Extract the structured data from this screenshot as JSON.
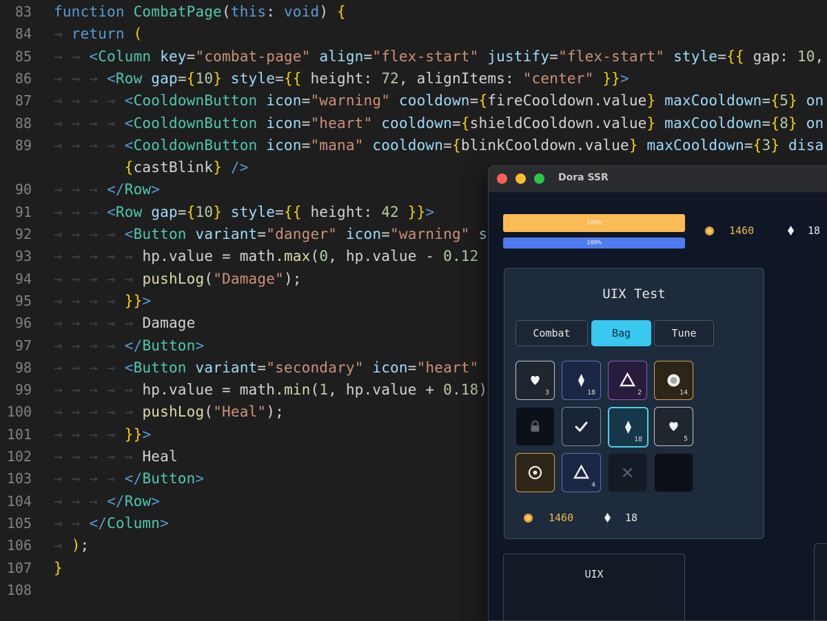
{
  "editor": {
    "lines": [
      {
        "n": "83",
        "t": [
          [
            "kw",
            "function "
          ],
          [
            "fn",
            "CombatPage"
          ],
          [
            "punct",
            "("
          ],
          [
            "kw",
            "this"
          ],
          [
            "punct",
            ": "
          ],
          [
            "kw",
            "void"
          ],
          [
            "punct",
            ") "
          ],
          [
            "brace",
            "{"
          ]
        ]
      },
      {
        "n": "84",
        "t": [
          [
            "guide",
            "→ "
          ],
          [
            "kw",
            "return "
          ],
          [
            "brace",
            "("
          ]
        ]
      },
      {
        "n": "85",
        "t": [
          [
            "guide",
            "→ → "
          ],
          [
            "tag",
            "<"
          ],
          [
            "comp",
            "Column "
          ],
          [
            "attr",
            "key"
          ],
          [
            "punct",
            "="
          ],
          [
            "str",
            "\"combat-page\" "
          ],
          [
            "attr",
            "align"
          ],
          [
            "punct",
            "="
          ],
          [
            "str",
            "\"flex-start\" "
          ],
          [
            "attr",
            "justify"
          ],
          [
            "punct",
            "="
          ],
          [
            "str",
            "\"flex-start\" "
          ],
          [
            "attr",
            "style"
          ],
          [
            "punct",
            "="
          ],
          [
            "brace",
            "{{ "
          ],
          [
            "var",
            "gap: "
          ],
          [
            "num",
            "10"
          ],
          [
            "punct",
            ","
          ]
        ]
      },
      {
        "n": "86",
        "t": [
          [
            "guide",
            "→ → → "
          ],
          [
            "tag",
            "<"
          ],
          [
            "comp",
            "Row "
          ],
          [
            "attr",
            "gap"
          ],
          [
            "punct",
            "="
          ],
          [
            "brace",
            "{"
          ],
          [
            "num",
            "10"
          ],
          [
            "brace",
            "}"
          ],
          [
            "attr",
            " style"
          ],
          [
            "punct",
            "="
          ],
          [
            "brace",
            "{{ "
          ],
          [
            "var",
            "height: "
          ],
          [
            "num",
            "72"
          ],
          [
            "punct",
            ", "
          ],
          [
            "var",
            "alignItems: "
          ],
          [
            "str",
            "\"center\" "
          ],
          [
            "brace",
            "}}"
          ],
          [
            "tag",
            ">"
          ]
        ]
      },
      {
        "n": "87",
        "t": [
          [
            "guide",
            "→ → → → "
          ],
          [
            "tag",
            "<"
          ],
          [
            "comp",
            "CooldownButton "
          ],
          [
            "attr",
            "icon"
          ],
          [
            "punct",
            "="
          ],
          [
            "str",
            "\"warning\" "
          ],
          [
            "attr",
            "cooldown"
          ],
          [
            "punct",
            "="
          ],
          [
            "brace",
            "{"
          ],
          [
            "var",
            "fireCooldown.value"
          ],
          [
            "brace",
            "}"
          ],
          [
            "attr",
            " maxCooldown"
          ],
          [
            "punct",
            "="
          ],
          [
            "brace",
            "{"
          ],
          [
            "num",
            "5"
          ],
          [
            "brace",
            "}"
          ],
          [
            "attr",
            " on"
          ]
        ]
      },
      {
        "n": "88",
        "t": [
          [
            "guide",
            "→ → → → "
          ],
          [
            "tag",
            "<"
          ],
          [
            "comp",
            "CooldownButton "
          ],
          [
            "attr",
            "icon"
          ],
          [
            "punct",
            "="
          ],
          [
            "str",
            "\"heart\" "
          ],
          [
            "attr",
            "cooldown"
          ],
          [
            "punct",
            "="
          ],
          [
            "brace",
            "{"
          ],
          [
            "var",
            "shieldCooldown.value"
          ],
          [
            "brace",
            "}"
          ],
          [
            "attr",
            " maxCooldown"
          ],
          [
            "punct",
            "="
          ],
          [
            "brace",
            "{"
          ],
          [
            "num",
            "8"
          ],
          [
            "brace",
            "}"
          ],
          [
            "attr",
            " on"
          ]
        ]
      },
      {
        "n": "89",
        "t": [
          [
            "guide",
            "→ → → → "
          ],
          [
            "tag",
            "<"
          ],
          [
            "comp",
            "CooldownButton "
          ],
          [
            "attr",
            "icon"
          ],
          [
            "punct",
            "="
          ],
          [
            "str",
            "\"mana\" "
          ],
          [
            "attr",
            "cooldown"
          ],
          [
            "punct",
            "="
          ],
          [
            "brace",
            "{"
          ],
          [
            "var",
            "blinkCooldown.value"
          ],
          [
            "brace",
            "}"
          ],
          [
            "attr",
            " maxCooldown"
          ],
          [
            "punct",
            "="
          ],
          [
            "brace",
            "{"
          ],
          [
            "num",
            "3"
          ],
          [
            "brace",
            "}"
          ],
          [
            "attr",
            " disa"
          ]
        ]
      },
      {
        "n": "",
        "t": [
          [
            "guide",
            "        "
          ],
          [
            "brace",
            "{"
          ],
          [
            "var",
            "castBlink"
          ],
          [
            "brace",
            "}"
          ],
          [
            "tag",
            " />"
          ]
        ]
      },
      {
        "n": "90",
        "t": [
          [
            "guide",
            "→ → → "
          ],
          [
            "tag",
            "</"
          ],
          [
            "comp",
            "Row"
          ],
          [
            "tag",
            ">"
          ]
        ]
      },
      {
        "n": "91",
        "t": [
          [
            "guide",
            "→ → → "
          ],
          [
            "tag",
            "<"
          ],
          [
            "comp",
            "Row "
          ],
          [
            "attr",
            "gap"
          ],
          [
            "punct",
            "="
          ],
          [
            "brace",
            "{"
          ],
          [
            "num",
            "10"
          ],
          [
            "brace",
            "}"
          ],
          [
            "attr",
            " style"
          ],
          [
            "punct",
            "="
          ],
          [
            "brace",
            "{{ "
          ],
          [
            "var",
            "height: "
          ],
          [
            "num",
            "42 "
          ],
          [
            "brace",
            "}}"
          ],
          [
            "tag",
            ">"
          ]
        ]
      },
      {
        "n": "92",
        "t": [
          [
            "guide",
            "→ → → → "
          ],
          [
            "tag",
            "<"
          ],
          [
            "comp",
            "Button "
          ],
          [
            "attr",
            "variant"
          ],
          [
            "punct",
            "="
          ],
          [
            "str",
            "\"danger\" "
          ],
          [
            "attr",
            "icon"
          ],
          [
            "punct",
            "="
          ],
          [
            "str",
            "\"warning\" "
          ],
          [
            "attr",
            "s"
          ]
        ]
      },
      {
        "n": "93",
        "t": [
          [
            "guide",
            "→ → → → → "
          ],
          [
            "var",
            "hp.value = math."
          ],
          [
            "meth",
            "max"
          ],
          [
            "punct",
            "("
          ],
          [
            "num",
            "0"
          ],
          [
            "punct",
            ", "
          ],
          [
            "var",
            "hp.value - "
          ],
          [
            "num",
            "0.12"
          ]
        ]
      },
      {
        "n": "94",
        "t": [
          [
            "guide",
            "→ → → → → "
          ],
          [
            "meth",
            "pushLog"
          ],
          [
            "punct",
            "("
          ],
          [
            "str",
            "\"Damage\""
          ],
          [
            "punct",
            ");"
          ]
        ]
      },
      {
        "n": "95",
        "t": [
          [
            "guide",
            "→ → → → "
          ],
          [
            "brace",
            "}}"
          ],
          [
            "tag",
            ">"
          ]
        ]
      },
      {
        "n": "96",
        "t": [
          [
            "guide",
            "→ → → → → "
          ],
          [
            "var",
            "Damage"
          ]
        ]
      },
      {
        "n": "97",
        "t": [
          [
            "guide",
            "→ → → → "
          ],
          [
            "tag",
            "</"
          ],
          [
            "comp",
            "Button"
          ],
          [
            "tag",
            ">"
          ]
        ]
      },
      {
        "n": "98",
        "t": [
          [
            "guide",
            "→ → → → "
          ],
          [
            "tag",
            "<"
          ],
          [
            "comp",
            "Button "
          ],
          [
            "attr",
            "variant"
          ],
          [
            "punct",
            "="
          ],
          [
            "str",
            "\"secondary\" "
          ],
          [
            "attr",
            "icon"
          ],
          [
            "punct",
            "="
          ],
          [
            "str",
            "\"heart\""
          ]
        ]
      },
      {
        "n": "99",
        "t": [
          [
            "guide",
            "→ → → → → "
          ],
          [
            "var",
            "hp.value = math."
          ],
          [
            "meth",
            "min"
          ],
          [
            "punct",
            "("
          ],
          [
            "num",
            "1"
          ],
          [
            "punct",
            ", "
          ],
          [
            "var",
            "hp.value + "
          ],
          [
            "num",
            "0.18"
          ],
          [
            "punct",
            ")"
          ]
        ]
      },
      {
        "n": "100",
        "t": [
          [
            "guide",
            "→ → → → → "
          ],
          [
            "meth",
            "pushLog"
          ],
          [
            "punct",
            "("
          ],
          [
            "str",
            "\"Heal\""
          ],
          [
            "punct",
            ");"
          ]
        ]
      },
      {
        "n": "101",
        "t": [
          [
            "guide",
            "→ → → → "
          ],
          [
            "brace",
            "}}"
          ],
          [
            "tag",
            ">"
          ]
        ]
      },
      {
        "n": "102",
        "t": [
          [
            "guide",
            "→ → → → → "
          ],
          [
            "var",
            "Heal"
          ]
        ]
      },
      {
        "n": "103",
        "t": [
          [
            "guide",
            "→ → → → "
          ],
          [
            "tag",
            "</"
          ],
          [
            "comp",
            "Button"
          ],
          [
            "tag",
            ">"
          ]
        ]
      },
      {
        "n": "104",
        "t": [
          [
            "guide",
            "→ → → "
          ],
          [
            "tag",
            "</"
          ],
          [
            "comp",
            "Row"
          ],
          [
            "tag",
            ">"
          ]
        ]
      },
      {
        "n": "105",
        "t": [
          [
            "guide",
            "→ → "
          ],
          [
            "tag",
            "</"
          ],
          [
            "comp",
            "Column"
          ],
          [
            "tag",
            ">"
          ]
        ]
      },
      {
        "n": "106",
        "t": [
          [
            "guide",
            "→ "
          ],
          [
            "brace",
            ")"
          ],
          [
            "punct",
            ";"
          ]
        ]
      },
      {
        "n": "107",
        "t": [
          [
            "brace",
            "}"
          ]
        ]
      },
      {
        "n": "108",
        "t": []
      }
    ]
  },
  "window": {
    "title": "Dora SSR",
    "hp_label": "100%",
    "mp_label": "100%",
    "hp_fraction": 1.0,
    "mp_fraction": 1.0,
    "gold": "1460",
    "gems": "18",
    "panel_title": "UIX Test",
    "tabs": [
      {
        "label": "Combat",
        "active": false
      },
      {
        "label": "Bag",
        "active": true
      },
      {
        "label": "Tune",
        "active": false
      }
    ],
    "inventory": [
      {
        "icon": "heart-icon",
        "count": "3"
      },
      {
        "icon": "gem-icon",
        "count": "18"
      },
      {
        "icon": "triangle-icon",
        "count": "2"
      },
      {
        "icon": "coin-icon",
        "count": "14"
      },
      {
        "icon": "lock-icon",
        "count": ""
      },
      {
        "icon": "check-icon",
        "count": ""
      },
      {
        "icon": "gem-icon",
        "count": "18"
      },
      {
        "icon": "heart-icon",
        "count": "5"
      },
      {
        "icon": "target-icon",
        "count": ""
      },
      {
        "icon": "triangle-icon",
        "count": "4"
      },
      {
        "icon": "close-icon",
        "count": ""
      },
      {
        "icon": "empty-slot",
        "count": ""
      }
    ],
    "footer_gold": "1460",
    "footer_gems": "18",
    "lower_panel_title": "UIX",
    "colors": {
      "hp_bar": "#fbbb55",
      "mp_bar": "#4f7cf0",
      "active_tab": "#38c8f0",
      "gold_text": "#f2b84b"
    }
  }
}
